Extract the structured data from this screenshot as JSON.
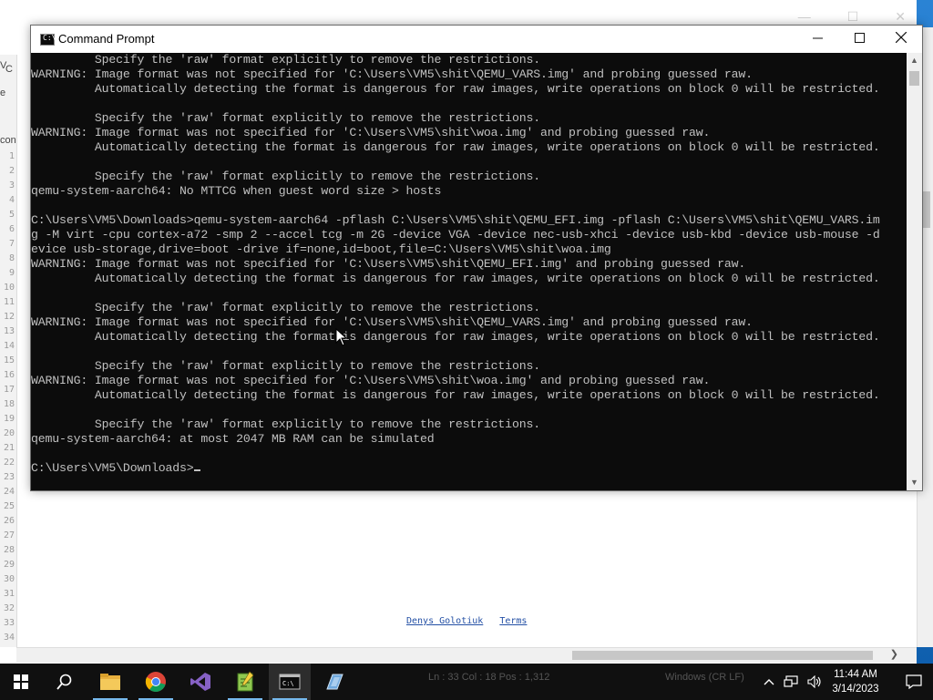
{
  "background_window": {
    "left_fragments": [
      "V",
      "C",
      "e",
      "con"
    ],
    "line_numbers": [
      "1",
      "2",
      "3",
      "4",
      "5",
      "6",
      "7",
      "8",
      "9",
      "10",
      "11",
      "12",
      "13",
      "14",
      "15",
      "16",
      "17",
      "18",
      "19",
      "20",
      "21",
      "22",
      "23",
      "24",
      "25",
      "26",
      "27",
      "28",
      "29",
      "30",
      "31",
      "32",
      "33",
      "34"
    ],
    "footer_links": [
      "Denys Golotiuk",
      "Terms"
    ]
  },
  "cmd": {
    "title": "Command Prompt",
    "lines": [
      "         Specify the 'raw' format explicitly to remove the restrictions.",
      "WARNING: Image format was not specified for 'C:\\Users\\VM5\\shit\\QEMU_VARS.img' and probing guessed raw.",
      "         Automatically detecting the format is dangerous for raw images, write operations on block 0 will be restricted.",
      "",
      "         Specify the 'raw' format explicitly to remove the restrictions.",
      "WARNING: Image format was not specified for 'C:\\Users\\VM5\\shit\\woa.img' and probing guessed raw.",
      "         Automatically detecting the format is dangerous for raw images, write operations on block 0 will be restricted.",
      "",
      "         Specify the 'raw' format explicitly to remove the restrictions.",
      "qemu-system-aarch64: No MTTCG when guest word size > hosts",
      "",
      "C:\\Users\\VM5\\Downloads>qemu-system-aarch64 -pflash C:\\Users\\VM5\\shit\\QEMU_EFI.img -pflash C:\\Users\\VM5\\shit\\QEMU_VARS.im",
      "g -M virt -cpu cortex-a72 -smp 2 --accel tcg -m 2G -device VGA -device nec-usb-xhci -device usb-kbd -device usb-mouse -d",
      "evice usb-storage,drive=boot -drive if=none,id=boot,file=C:\\Users\\VM5\\shit\\woa.img",
      "WARNING: Image format was not specified for 'C:\\Users\\VM5\\shit\\QEMU_EFI.img' and probing guessed raw.",
      "         Automatically detecting the format is dangerous for raw images, write operations on block 0 will be restricted.",
      "",
      "         Specify the 'raw' format explicitly to remove the restrictions.",
      "WARNING: Image format was not specified for 'C:\\Users\\VM5\\shit\\QEMU_VARS.img' and probing guessed raw.",
      "         Automatically detecting the format is dangerous for raw images, write operations on block 0 will be restricted.",
      "",
      "         Specify the 'raw' format explicitly to remove the restrictions.",
      "WARNING: Image format was not specified for 'C:\\Users\\VM5\\shit\\woa.img' and probing guessed raw.",
      "         Automatically detecting the format is dangerous for raw images, write operations on block 0 will be restricted.",
      "",
      "         Specify the 'raw' format explicitly to remove the restrictions.",
      "qemu-system-aarch64: at most 2047 MB RAM can be simulated",
      ""
    ],
    "prompt": "C:\\Users\\VM5\\Downloads>"
  },
  "taskbar": {
    "items": [
      {
        "name": "start-button",
        "icon": "windows-logo-icon",
        "active": false
      },
      {
        "name": "search-button",
        "icon": "search-icon",
        "active": false
      },
      {
        "name": "file-explorer-button",
        "icon": "folder-icon",
        "active": true
      },
      {
        "name": "chrome-button",
        "icon": "chrome-icon",
        "active": true
      },
      {
        "name": "visual-studio-button",
        "icon": "visual-studio-icon",
        "active": false
      },
      {
        "name": "notepad-plus-plus-button",
        "icon": "notepad-plus-plus-icon",
        "active": true
      },
      {
        "name": "command-prompt-button",
        "icon": "cmd-icon",
        "active": true
      },
      {
        "name": "app-button",
        "icon": "blue-app-icon",
        "active": false
      }
    ],
    "status_ghost": "Ln : 33    Col : 18    Pos : 1,312",
    "line_ending_ghost": "Windows (CR LF)",
    "clock_time": "11:44 AM",
    "clock_date": "3/14/2023",
    "colors": {
      "taskbar_bg": "#101010",
      "active_indicator": "#76b9ed",
      "console_bg": "#0c0c0c",
      "console_fg": "#c0c0c0"
    }
  }
}
